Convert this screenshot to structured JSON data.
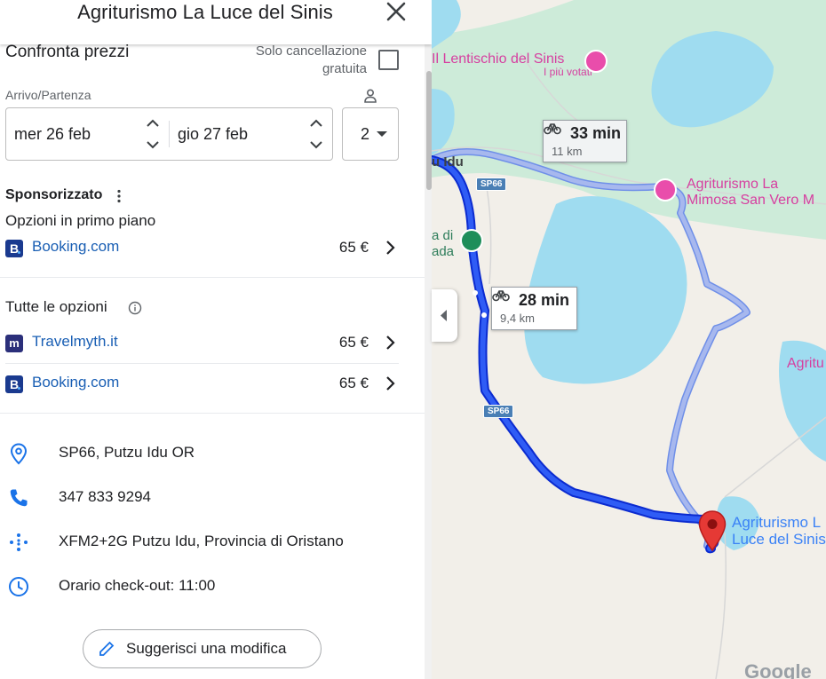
{
  "panel": {
    "title": "Agriturismo La Luce del Sinis",
    "compare": {
      "title": "Confronta prezzi",
      "free_cancellation_label": "Solo cancellazione gratuita",
      "dates_label": "Arrivo/Partenza",
      "checkin": "mer 26 feb",
      "checkout": "gio 27 feb",
      "guests": "2"
    },
    "sponsored": {
      "title": "Sponsorizzato",
      "featured_title": "Opzioni in primo piano",
      "offers": [
        {
          "logo": "B",
          "partner": "Booking.com",
          "price": "65 €"
        }
      ]
    },
    "all_options": {
      "title": "Tutte le opzioni",
      "offers": [
        {
          "logo": "m",
          "partner": "Travelmyth.it",
          "price": "65 €"
        },
        {
          "logo": "B",
          "partner": "Booking.com",
          "price": "65 €"
        }
      ]
    },
    "details": [
      {
        "icon": "location-pin-icon",
        "text": "SP66, Putzu Idu OR"
      },
      {
        "icon": "phone-icon",
        "text": "347 833 9294"
      },
      {
        "icon": "plus-code-icon",
        "text": "XFM2+2G Putzu Idu, Provincia di Oristano"
      },
      {
        "icon": "clock-icon",
        "text": "Orario check-out: 11:00"
      }
    ],
    "suggest_edit_label": "Suggerisci una modifica"
  },
  "map": {
    "labels": {
      "lentischio": "Il Lentischio del Sinis",
      "lentischio_sub": "I più votati",
      "mimosa_line1": "Agriturismo La",
      "mimosa_line2": "Mimosa San Vero M",
      "destination_line1": "Agriturismo L",
      "destination_line2": "Luce del Sinis",
      "agritu": "Agritu",
      "putzu_idu": "u Idu",
      "road_sp66_a": "SP66",
      "road_sp66_b": "SP66",
      "place_a_line1": "a di",
      "place_a_line2": "ada",
      "google": "Google"
    },
    "routes": [
      {
        "id": "primary",
        "time": "28 min",
        "distance": "9,4 km"
      },
      {
        "id": "alternative",
        "time": "33 min",
        "distance": "11 km"
      }
    ],
    "colors": {
      "route_primary": "#1a3ee8",
      "route_alternative": "#a7b8ee",
      "water": "#9fdcf0",
      "park": "#cdebd9",
      "land": "#f2efe9",
      "hotel_pin": "#e94dab",
      "destination_pin": "#e53935"
    }
  }
}
